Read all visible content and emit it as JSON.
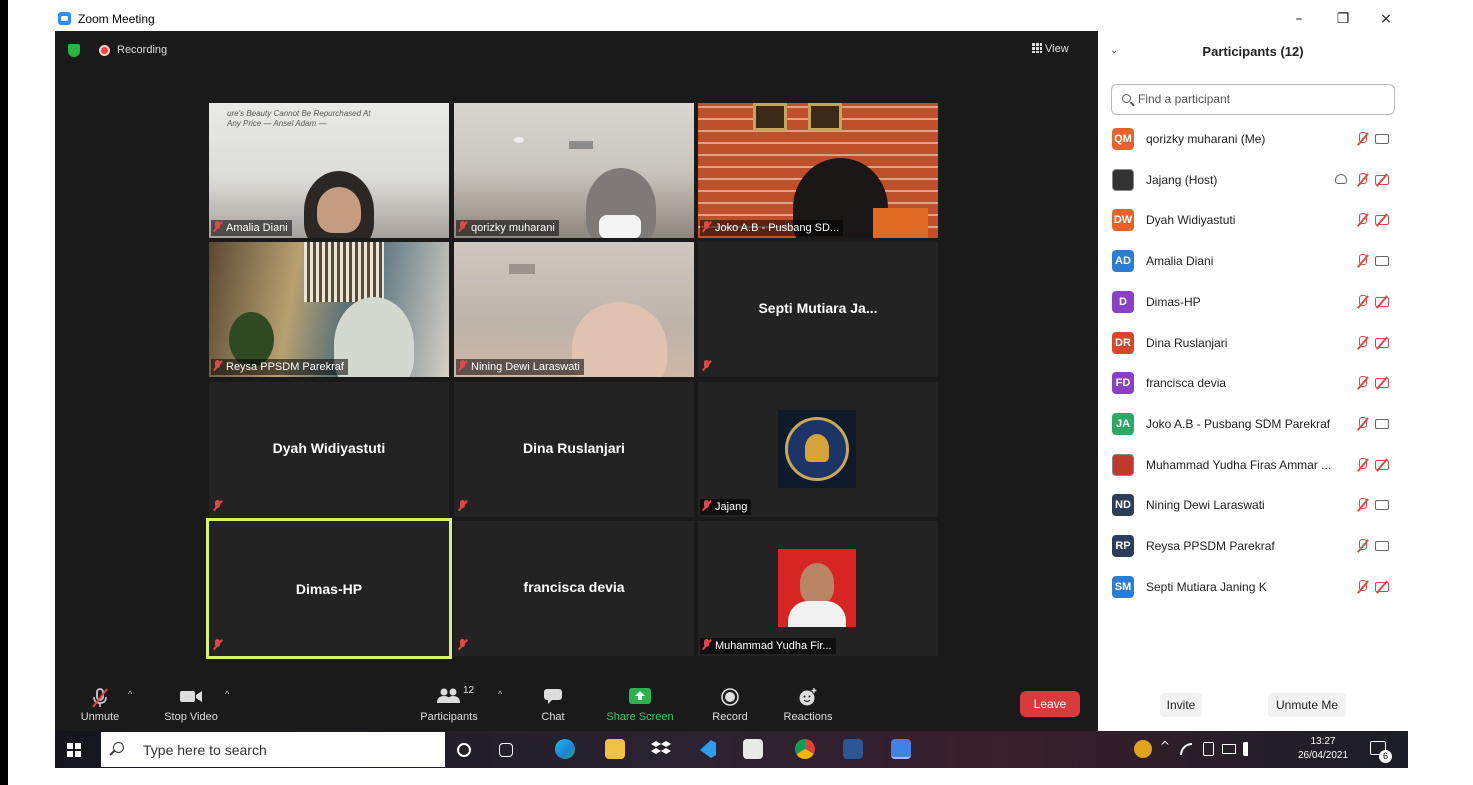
{
  "window": {
    "title": "Zoom Meeting",
    "minimize_glyph": "–",
    "restore_glyph": "❐",
    "close_glyph": "×"
  },
  "meeting": {
    "recording_label": "Recording",
    "view_label": "View",
    "tiles": [
      {
        "name": "Amalia Diani",
        "video": true
      },
      {
        "name": "qorizky muharani",
        "video": true
      },
      {
        "name": "Joko A.B - Pusbang SD...",
        "video": true
      },
      {
        "name": "Reysa PPSDM Parekraf",
        "video": true
      },
      {
        "name": "Nining Dewi Laraswati",
        "video": true
      },
      {
        "name": "Septi Mutiara Ja...",
        "video": false
      },
      {
        "name": "Dyah Widiyastuti",
        "video": false
      },
      {
        "name": "Dina Ruslanjari",
        "video": false
      },
      {
        "name": "Jajang",
        "video": false,
        "profile_image": "emblem"
      },
      {
        "name": "Dimas-HP",
        "video": false,
        "active_speaker": true
      },
      {
        "name": "francisca devia",
        "video": false
      },
      {
        "name": "Muhammad Yudha Fir...",
        "video": false,
        "profile_image": "photo"
      }
    ],
    "wall_poster_text": "ure's Beauty Cannot Be Repurchased At Any Price — Ansel Adam —"
  },
  "toolbar": {
    "unmute": "Unmute",
    "stop_video": "Stop Video",
    "participants": "Participants",
    "participants_count": "12",
    "chat": "Chat",
    "share_screen": "Share Screen",
    "record": "Record",
    "reactions": "Reactions",
    "leave": "Leave",
    "caret": "^"
  },
  "panel": {
    "title": "Participants (12)",
    "collapse_glyph": "⌄",
    "search_placeholder": "Find a participant",
    "participants": [
      {
        "initials": "QM",
        "name": "qorizky muharani (Me)",
        "color": "#e8632a",
        "video": true
      },
      {
        "initials": "",
        "name": "Jajang (Host)",
        "color": "#333333",
        "video": false,
        "cloud": true
      },
      {
        "initials": "DW",
        "name": "Dyah Widiyastuti",
        "color": "#e8632a",
        "video": false
      },
      {
        "initials": "AD",
        "name": "Amalia Diani",
        "color": "#2b7cd3",
        "video": true
      },
      {
        "initials": "D",
        "name": "Dimas-HP",
        "color": "#8a3fc7",
        "video": false
      },
      {
        "initials": "DR",
        "name": "Dina Ruslanjari",
        "color": "#d9442a",
        "video": false
      },
      {
        "initials": "FD",
        "name": "francisca devia",
        "color": "#8a3fc7",
        "video": false
      },
      {
        "initials": "JA",
        "name": "Joko A.B - Pusbang SDM Parekraf",
        "color": "#2aa866",
        "video": true
      },
      {
        "initials": "",
        "name": "Muhammad Yudha Firas Ammar ...",
        "color": "#c0392b",
        "video": false
      },
      {
        "initials": "ND",
        "name": "Nining Dewi Laraswati",
        "color": "#2c3e5a",
        "video": true
      },
      {
        "initials": "RP",
        "name": "Reysa PPSDM Parekraf",
        "color": "#2c3e5a",
        "video": true
      },
      {
        "initials": "SM",
        "name": "Septi Mutiara Janing K",
        "color": "#2b7cd3",
        "video": false
      }
    ],
    "invite": "Invite",
    "unmute_me": "Unmute Me"
  },
  "taskbar": {
    "search_placeholder": "Type here to search",
    "time": "13:27",
    "date": "26/04/2021",
    "notification_count": "6"
  }
}
